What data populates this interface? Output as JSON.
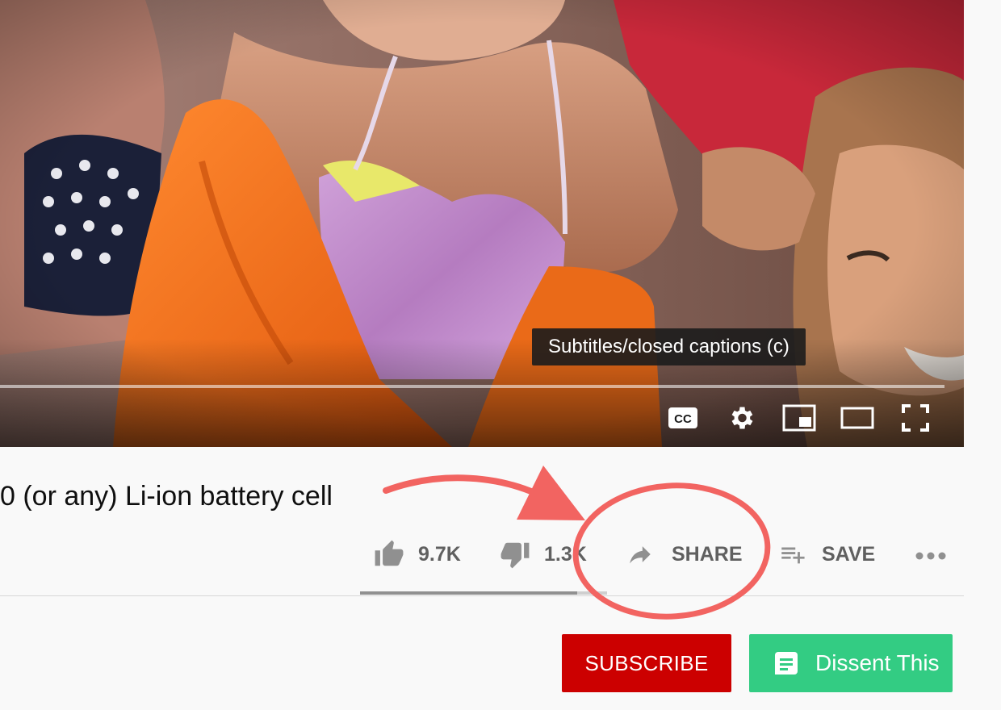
{
  "player": {
    "tooltip": "Subtitles/closed captions (c)",
    "progress": 0.0,
    "controls": [
      {
        "name": "subtitles",
        "icon": "cc-icon",
        "label": "CC"
      },
      {
        "name": "settings",
        "icon": "gear-icon"
      },
      {
        "name": "miniplayer",
        "icon": "miniplayer-icon"
      },
      {
        "name": "theater-mode",
        "icon": "theater-icon"
      },
      {
        "name": "fullscreen",
        "icon": "fullscreen-icon"
      }
    ]
  },
  "video": {
    "title": "0 (or any) Li-ion battery cell"
  },
  "actions": {
    "like_count": "9.7K",
    "dislike_count": "1.3K",
    "share_label": "SHARE",
    "save_label": "SAVE",
    "icons": {
      "like": "thumbs-up-icon",
      "dislike": "thumbs-down-icon",
      "share": "share-arrow-icon",
      "save": "playlist-add-icon",
      "more": "more-dots-icon"
    },
    "like_ratio": 0.88
  },
  "channel": {
    "subscribe_label": "SUBSCRIBE",
    "dissent_label": "Dissent This"
  },
  "colors": {
    "subscribe": "#cc0000",
    "dissent": "#33cc83",
    "annotation": "#f26461",
    "tooltip_bg": "#1c1c1c"
  }
}
